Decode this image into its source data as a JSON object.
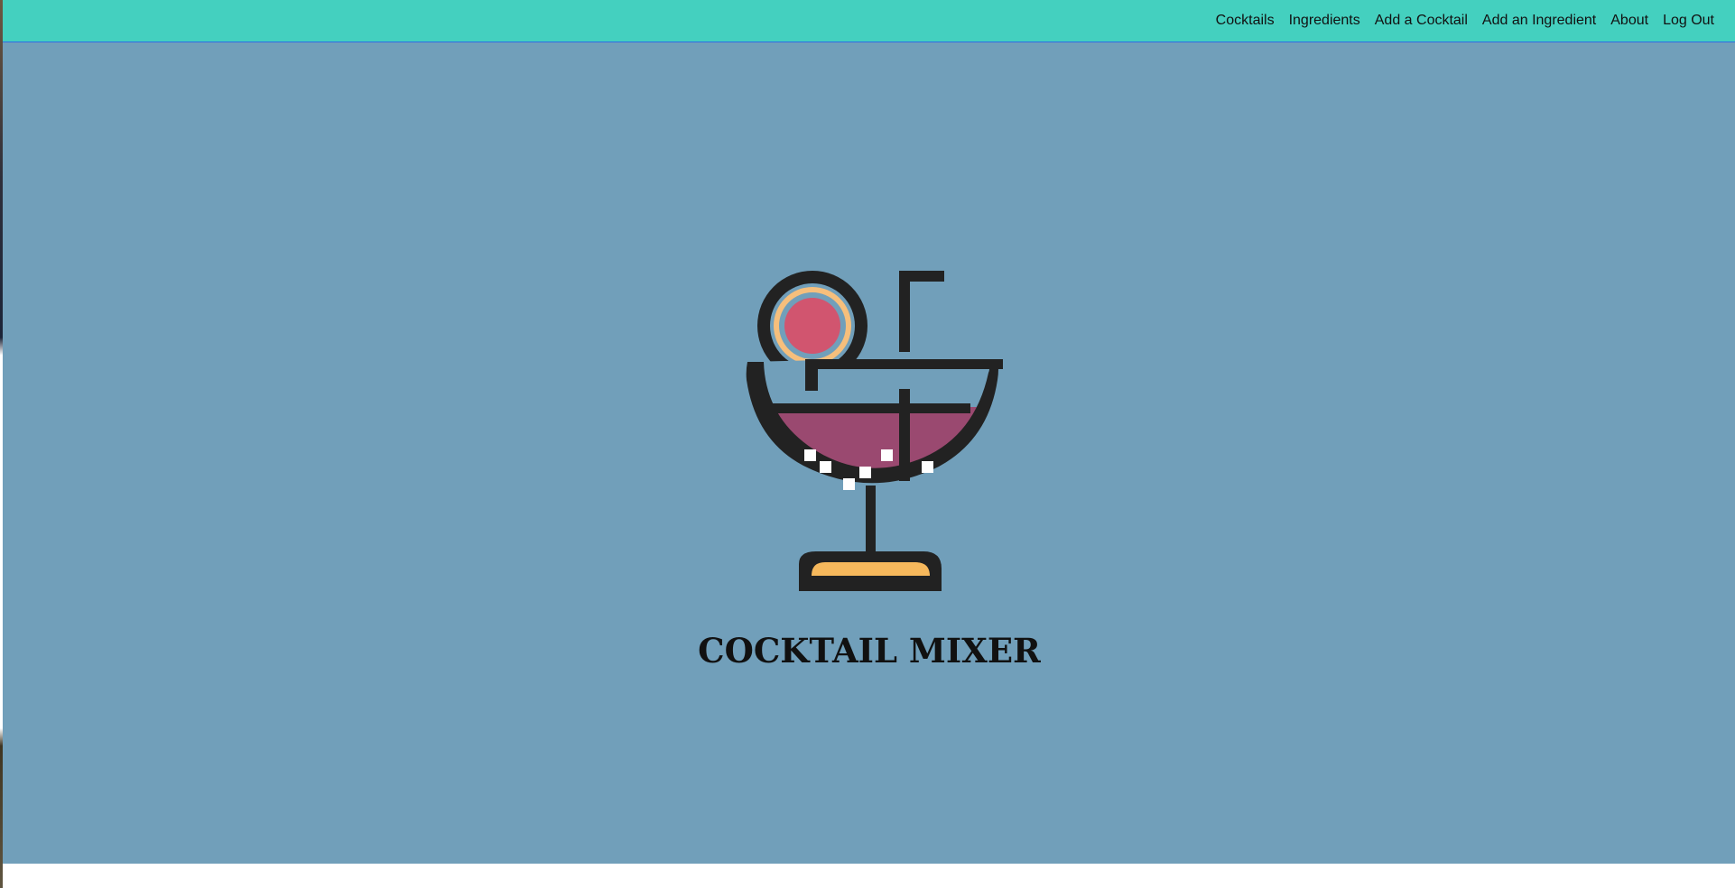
{
  "nav": {
    "links": [
      {
        "label": "Cocktails"
      },
      {
        "label": "Ingredients"
      },
      {
        "label": "Add a Cocktail"
      },
      {
        "label": "Add an Ingredient"
      },
      {
        "label": "About"
      },
      {
        "label": "Log Out"
      }
    ]
  },
  "hero": {
    "title": "COCKTAIL MIXER",
    "logo_icon": "cocktail-glass-icon"
  },
  "colors": {
    "navbar_background": "#44d0bf",
    "hero_background": "#719fba",
    "logo_outline": "#222222",
    "drink_fill": "#9a4970",
    "garnish_inner": "#d1556f",
    "garnish_peel": "#f6bf7c",
    "base_fill": "#f6b85c"
  }
}
